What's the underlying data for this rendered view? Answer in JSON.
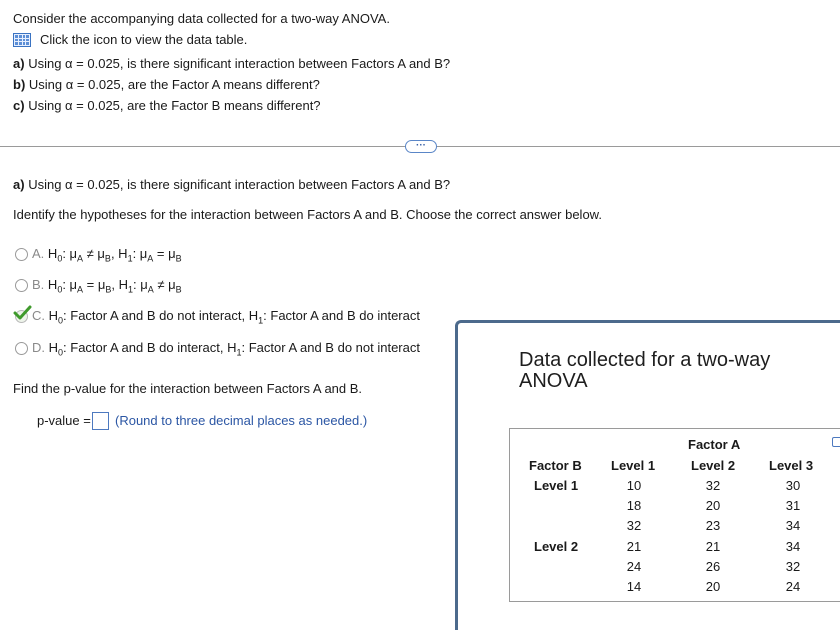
{
  "intro": {
    "line1": "Consider the accompanying data collected for a two-way ANOVA.",
    "table_link": "Click the icon to view the data table.",
    "parts": [
      {
        "label": "a)",
        "text": "Using α = 0.025, is there significant interaction between Factors A and B?"
      },
      {
        "label": "b)",
        "text": "Using α = 0.025, are the Factor A means different?"
      },
      {
        "label": "c)",
        "text": "Using α = 0.025, are the Factor B means different?"
      }
    ]
  },
  "divider": {
    "button_label": "···"
  },
  "part_a": {
    "label": "a)",
    "question": "Using α = 0.025, is there significant interaction between Factors A and B?",
    "instruction": "Identify the hypotheses for the interaction between Factors A and B. Choose the correct answer below.",
    "options": [
      {
        "letter": "A.",
        "h0": "H",
        "h0_sub": "0",
        "h0_text": ": μ",
        "h0_a": "A",
        "h0_rel": " ≠ μ",
        "h0_b": "B",
        "h1": ", H",
        "h1_sub": "1",
        "h1_text": ": μ",
        "h1_a": "A",
        "h1_rel": " = μ",
        "h1_b": "B",
        "selected": false
      },
      {
        "letter": "B.",
        "h0": "H",
        "h0_sub": "0",
        "h0_text": ": μ",
        "h0_a": "A",
        "h0_rel": " = μ",
        "h0_b": "B",
        "h1": ", H",
        "h1_sub": "1",
        "h1_text": ": μ",
        "h1_a": "A",
        "h1_rel": " ≠ μ",
        "h1_b": "B",
        "selected": false
      },
      {
        "letter": "C.",
        "h0": "H",
        "h0_sub": "0",
        "h0_text": ": Factor A and B do not interact, H",
        "h1_sub": "1",
        "h1_text": ": Factor A and B do interact",
        "selected": true
      },
      {
        "letter": "D.",
        "h0": "H",
        "h0_sub": "0",
        "h0_text": ": Factor A and B do interact, H",
        "h1_sub": "1",
        "h1_text": ": Factor A and B do not interact",
        "selected": false
      }
    ],
    "pvalue_prompt": "Find the p-value for the interaction between Factors A and B.",
    "pvalue_label": "p-value =",
    "pvalue_value": "",
    "pvalue_hint": "(Round to three decimal places as needed.)"
  },
  "data_panel": {
    "title": "Data collected for a two-way ANOVA",
    "factor_a": "Factor A",
    "factor_b": "Factor B",
    "levels_a": [
      "Level 1",
      "Level 2",
      "Level 3"
    ],
    "rows": [
      {
        "level_b": "Level 1",
        "values": [
          [
            10,
            32,
            30
          ],
          [
            18,
            20,
            31
          ],
          [
            32,
            23,
            34
          ]
        ]
      },
      {
        "level_b": "Level 2",
        "values": [
          [
            21,
            21,
            34
          ],
          [
            24,
            26,
            32
          ],
          [
            14,
            20,
            24
          ]
        ]
      }
    ]
  }
}
